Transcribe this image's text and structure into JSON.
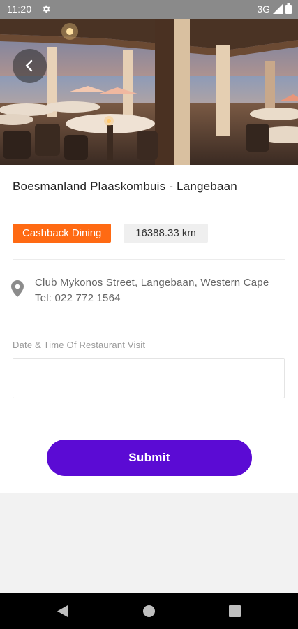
{
  "status_bar": {
    "time": "11:20",
    "network": "3G",
    "icons": [
      "gear-icon",
      "signal-icon",
      "battery-icon"
    ]
  },
  "hero": {
    "image_subject": "restaurant terrace overlooking the sea at sunset",
    "back_icon": "chevron-left-icon"
  },
  "restaurant": {
    "name": "Boesmanland Plaaskombuis - Langebaan",
    "tag": "Cashback Dining",
    "distance": "16388.33 km",
    "address_line": "Club Mykonos Street, Langebaan, Western Cape",
    "phone_line": "Tel: 022 772 1564",
    "location_icon": "map-pin-icon"
  },
  "form": {
    "date_label": "Date & Time Of Restaurant Visit",
    "date_value": "",
    "submit_label": "Submit"
  },
  "nav": {
    "icons": [
      "back-triangle-icon",
      "home-circle-icon",
      "recents-square-icon"
    ]
  },
  "colors": {
    "accent": "#5b0bd4",
    "tag": "#ff6a13",
    "status_bar": "#8a8a8a",
    "page_background": "#f2f2f2"
  }
}
